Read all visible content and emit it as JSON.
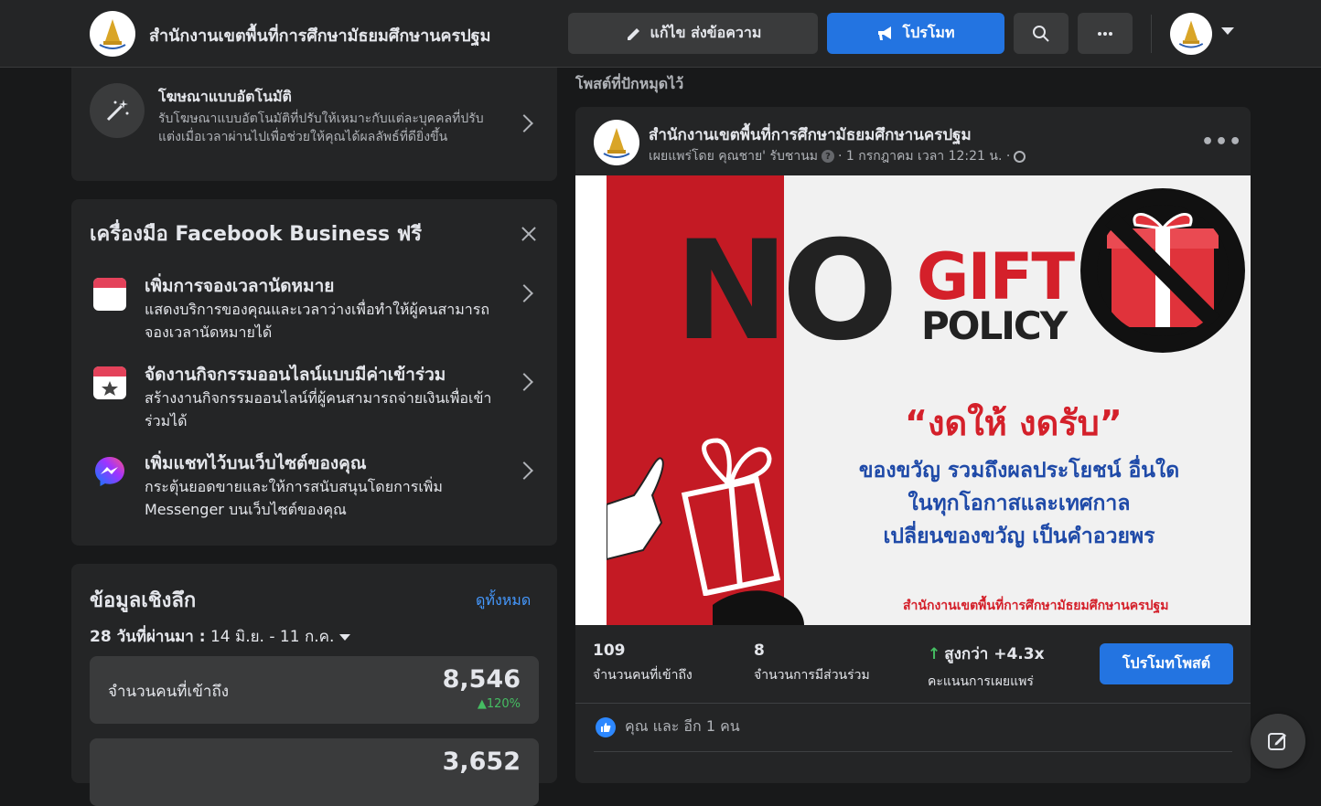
{
  "header": {
    "page_name": "สำนักงานเขตพื้นที่การศึกษามัธยมศึกษานครปฐม",
    "edit_button": "แก้ไข ส่งข้อความ",
    "promote_button": "โปรโมท",
    "icons": [
      "pencil-icon",
      "megaphone-icon",
      "search-icon",
      "more-icon",
      "caret-down-icon"
    ]
  },
  "auto_ads": {
    "title": "โฆษณาแบบอัตโนมัติ",
    "description": "รับโฆษณาแบบอัตโนมัติที่ปรับให้เหมาะกับแต่ละบุคคลที่ปรับแต่งเมื่อเวลาผ่านไปเพื่อช่วยให้คุณได้ผลลัพธ์ที่ดียิ่งขึ้น",
    "icon": "magic-wand-icon"
  },
  "business_tools": {
    "title": "เครื่องมือ Facebook Business ฟรี",
    "items": [
      {
        "title": "เพิ่มการจองเวลานัดหมาย",
        "description": "แสดงบริการของคุณและเวลาว่างเพื่อทำให้ผู้คนสามารถจองเวลานัดหมายได้",
        "icon": "calendar-icon"
      },
      {
        "title": "จัดงานกิจกรรมออนไลน์แบบมีค่าเข้าร่วม",
        "description": "สร้างงานกิจกรรมออนไลน์ที่ผู้คนสามารถจ่ายเงินเพื่อเข้าร่วมได้",
        "icon": "calendar-star-icon"
      },
      {
        "title": "เพิ่มแชทไว้บนเว็บไซต์ของคุณ",
        "description": "กระตุ้นยอดขายและให้การสนับสนุนโดยการเพิ่ม Messenger บนเว็บไซต์ของคุณ",
        "icon": "messenger-icon"
      }
    ]
  },
  "insights": {
    "title": "ข้อมูลเชิงลึก",
    "see_all": "ดูทั้งหมด",
    "range_prefix": "28 วันที่ผ่านมา :",
    "range": "14 มิ.ย. - 11 ก.ค.",
    "stats": [
      {
        "label": "จำนวนคนที่เข้าถึง",
        "value": "8,546",
        "change": "120%"
      },
      {
        "label": "",
        "value": "3,652",
        "change": ""
      }
    ]
  },
  "pinned": {
    "label": "โพสต์ที่ปักหมุดไว้",
    "author": "สำนักงานเขตพื้นที่การศึกษามัธยมศึกษานครปฐม",
    "meta_prefix": "เผยแพร่โดย คุณชาย' รับชานม",
    "meta_date": "· 1 กรกฎาคม เวลา 12:21 น. ·",
    "image": {
      "word_no": "NO",
      "word_gift": "GIFT",
      "word_policy": "POLICY",
      "slogan": "“งดให้ งดรับ”",
      "lines": [
        "ของขวัญ รวมถึงผลประโยชน์ อื่นใด",
        "ในทุกโอกาสและเทศกาล",
        "เปลี่ยนของขวัญ เป็นคำอวยพร"
      ],
      "org": "สำนักงานเขตพื้นที่การศึกษามัธยมศึกษานครปฐม"
    },
    "stats": [
      {
        "value": "109",
        "label": "จำนวนคนที่เข้าถึง"
      },
      {
        "value": "8",
        "label": "จำนวนการมีส่วนร่วม"
      },
      {
        "value": "สูงกว่า +4.3x",
        "label": "คะแนนการเผยแพร่"
      }
    ],
    "promote_post": "โปรโมทโพสต์",
    "reactions": "คุณ และ อีก 1 คน"
  },
  "colors": {
    "accent": "#2374e1",
    "link": "#4599ff",
    "positive": "#45bd62",
    "brand_red": "#d4202a"
  }
}
